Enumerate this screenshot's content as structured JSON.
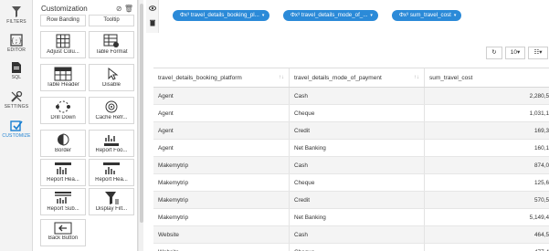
{
  "rail": {
    "items": [
      {
        "label": "FILTERS",
        "icon": "funnel-icon"
      },
      {
        "label": "EDITOR",
        "icon": "code-braces-icon"
      },
      {
        "label": "SQL",
        "icon": "sql-doc-icon"
      },
      {
        "label": "SETTINGS",
        "icon": "wrench-icon"
      },
      {
        "label": "CUSTOMIZE",
        "icon": "customize-check-icon",
        "active": true
      }
    ]
  },
  "panel": {
    "title": "Customization",
    "tiles": [
      {
        "label": "Row Banding"
      },
      {
        "label": "Tooltip"
      },
      {
        "label": "Adjust Colu..."
      },
      {
        "label": "Table Format"
      },
      {
        "label": "Table Header"
      },
      {
        "label": "Disable"
      },
      {
        "label": "Drill Down"
      },
      {
        "label": "Cache Refr..."
      },
      {
        "label": "Border"
      },
      {
        "label": "Report Foo..."
      },
      {
        "label": "Report Hea..."
      },
      {
        "label": "Report Hea..."
      },
      {
        "label": "Report Sub..."
      },
      {
        "label": "Display Filt..."
      },
      {
        "label": "Back Button"
      }
    ]
  },
  "fields": [
    {
      "label": "travel_details_booking_pl..."
    },
    {
      "label": "travel_details_mode_of_..."
    },
    {
      "label": "sum_travel_cost"
    }
  ],
  "toolbar": {
    "refresh_icon": "refresh-icon",
    "page_size": "10",
    "columns_icon": "columns-icon"
  },
  "table": {
    "columns": [
      "travel_details_booking_platform",
      "travel_details_mode_of_payment",
      "sum_travel_cost"
    ],
    "rows": [
      [
        "Agent",
        "Cash",
        "2,280,5"
      ],
      [
        "Agent",
        "Cheque",
        "1,031,1"
      ],
      [
        "Agent",
        "Credit",
        "169,3"
      ],
      [
        "Agent",
        "Net Banking",
        "160,1"
      ],
      [
        "Makemytrip",
        "Cash",
        "874,0"
      ],
      [
        "Makemytrip",
        "Cheque",
        "125,6"
      ],
      [
        "Makemytrip",
        "Credit",
        "570,5"
      ],
      [
        "Makemytrip",
        "Net Banking",
        "5,149,4"
      ],
      [
        "Website",
        "Cash",
        "464,5"
      ],
      [
        "Website",
        "Cheque",
        "477,4"
      ]
    ]
  },
  "colors": {
    "accent": "#2b8ad8",
    "row_alt": "#f4f4f4"
  }
}
